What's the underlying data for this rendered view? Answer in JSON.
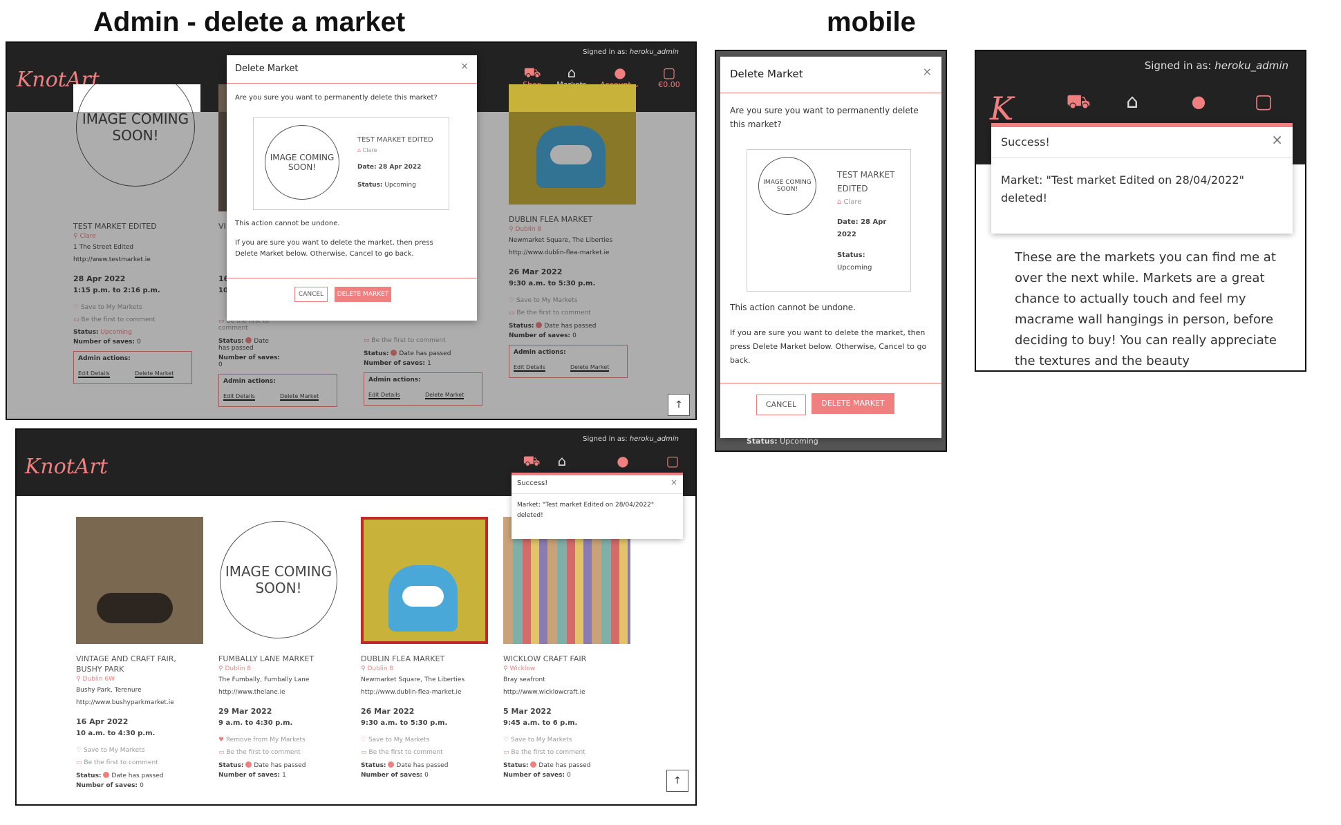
{
  "headings": {
    "left": "Admin - delete a market",
    "right": "mobile"
  },
  "desktop": {
    "signed_in_label": "Signed in as:",
    "username": "heroku_admin",
    "logo": "KnotArt",
    "nav": {
      "shop": "Shop",
      "markets": "Markets",
      "account": "Account",
      "bag": "€0.00"
    },
    "icons": {
      "shop": "cart-plus-icon",
      "markets": "store-icon",
      "account": "user-icon",
      "bag": "bag-icon",
      "scroll": "arrow-up-icon"
    },
    "accent_color": "#f08080",
    "navbar_color": "#222222"
  },
  "modal": {
    "title": "Delete Market",
    "question": "Are you sure you want to permanently delete this market?",
    "card_title": "TEST MARKET EDITED",
    "card_county": "Clare",
    "card_date": "Date: 28 Apr 2022",
    "card_status_label": "Status:",
    "card_status": "Upcoming",
    "image_text": "IMAGE COMING SOON!",
    "warning": "This action cannot be undone.",
    "instructions": "If you are sure you want to delete the market, then press Delete Market below. Otherwise, Cancel to go back.",
    "cancel": "CANCEL",
    "delete": "DELETE MARKET"
  },
  "shot1_cards": [
    {
      "title": "TEST MARKET EDITED",
      "county": "Clare",
      "address": "1 The Street Edited",
      "url": "http://www.testmarket.ie",
      "date": "28 Apr 2022",
      "time": "1:15 p.m. to 2:16 p.m.",
      "save": "Save to My Markets",
      "comment": "Be the first to comment",
      "status_label": "Status:",
      "status": "Upcoming",
      "saves_label": "Number of saves:",
      "saves": "0",
      "admin": "Admin actions:",
      "edit": "Edit Details",
      "delete": "Delete Market"
    },
    {
      "title": "VI",
      "county": "",
      "address": "",
      "url": "",
      "date": "16",
      "time": "10",
      "save": "",
      "comment": "Be the first to comment",
      "status_label": "Status:",
      "status": "Date has passed",
      "saves_label": "Number of saves:",
      "saves": "0",
      "admin": "Admin actions:",
      "edit": "Edit Details",
      "delete": "Delete Market"
    },
    {
      "title": "",
      "county": "",
      "address": "",
      "url": "",
      "date": "",
      "time": "",
      "save": "",
      "comment": "Be the first to comment",
      "status_label": "Status:",
      "status": "Date has passed",
      "saves_label": "Number of saves:",
      "saves": "1",
      "admin": "Admin actions:",
      "edit": "Edit Details",
      "delete": "Delete Market"
    },
    {
      "title": "DUBLIN FLEA MARKET",
      "county": "Dublin 8",
      "address": "Newmarket Square, The Liberties",
      "url": "http://www.dublin-flea-market.ie",
      "date": "26 Mar 2022",
      "time": "9:30 a.m. to 5:30 p.m.",
      "save": "Save to My Markets",
      "comment": "Be the first to comment",
      "status_label": "Status:",
      "status": "Date has passed",
      "saves_label": "Number of saves:",
      "saves": "0",
      "admin": "Admin actions:",
      "edit": "Edit Details",
      "delete": "Delete Market"
    }
  ],
  "shot2_cards": [
    {
      "title": "VINTAGE AND CRAFT FAIR, BUSHY PARK",
      "county": "Dublin 6W",
      "address": "Bushy Park, Terenure",
      "url": "http://www.bushyparkmarket.ie",
      "date": "16 Apr 2022",
      "time": "10 a.m. to 4:30 p.m.",
      "save": "Save to My Markets",
      "comment": "Be the first to comment",
      "status_label": "Status:",
      "status": "Date has passed",
      "saves_label": "Number of saves:",
      "saves": "0"
    },
    {
      "title": "FUMBALLY LANE MARKET",
      "county": "Dublin 8",
      "address": "The Fumbally, Fumbally Lane",
      "url": "http://www.thelane.ie",
      "date": "29 Mar 2022",
      "time": "9 a.m. to 4:30 p.m.",
      "save": "Remove from My Markets",
      "comment": "Be the first to comment",
      "status_label": "Status:",
      "status": "Date has passed",
      "saves_label": "Number of saves:",
      "saves": "1"
    },
    {
      "title": "DUBLIN FLEA MARKET",
      "county": "Dublin 8",
      "address": "Newmarket Square, The Liberties",
      "url": "http://www.dublin-flea-market.ie",
      "date": "26 Mar 2022",
      "time": "9:30 a.m. to 5:30 p.m.",
      "save": "Save to My Markets",
      "comment": "Be the first to comment",
      "status_label": "Status:",
      "status": "Date has passed",
      "saves_label": "Number of saves:",
      "saves": "0"
    },
    {
      "title": "WICKLOW CRAFT FAIR",
      "county": "Wicklow",
      "address": "Bray seafront",
      "url": "http://www.wicklowcraft.ie",
      "date": "5 Mar 2022",
      "time": "9:45 a.m. to 6 p.m.",
      "save": "Save to My Markets",
      "comment": "Be the first to comment",
      "status_label": "Status:",
      "status": "Date has passed",
      "saves_label": "Number of saves:",
      "saves": "0"
    }
  ],
  "toast": {
    "title": "Success!",
    "message": "Market: \"Test market Edited on 28/04/2022\" deleted!"
  },
  "mobile_modal": {
    "title": "Delete Market",
    "question": "Are you sure you want to permanently delete this market?",
    "card_title": "TEST MARKET EDITED",
    "card_county": "Clare",
    "card_date": "Date: 28 Apr 2022",
    "card_status_label": "Status:",
    "card_status": "Upcoming",
    "image_text": "IMAGE COMING SOON!",
    "warning": "This action cannot be undone.",
    "instructions": "If you are sure you want to delete the market, then press Delete Market below. Otherwise, Cancel to go back.",
    "cancel": "CANCEL",
    "delete": "DELETE MARKET",
    "below_status_label": "Status:",
    "below_status": "Upcoming"
  },
  "mobile_success": {
    "signed_in_label": "Signed in as:",
    "username": "heroku_admin",
    "logo_letter": "K",
    "toast_title": "Success!",
    "toast_message": "Market: \"Test market Edited on 28/04/2022\" deleted!",
    "body_text": "These are the markets you can find me at over the next while. Markets are a great chance to actually touch and feel my macrame wall hangings in person, before deciding to buy! You can really appreciate the textures and the beauty"
  }
}
